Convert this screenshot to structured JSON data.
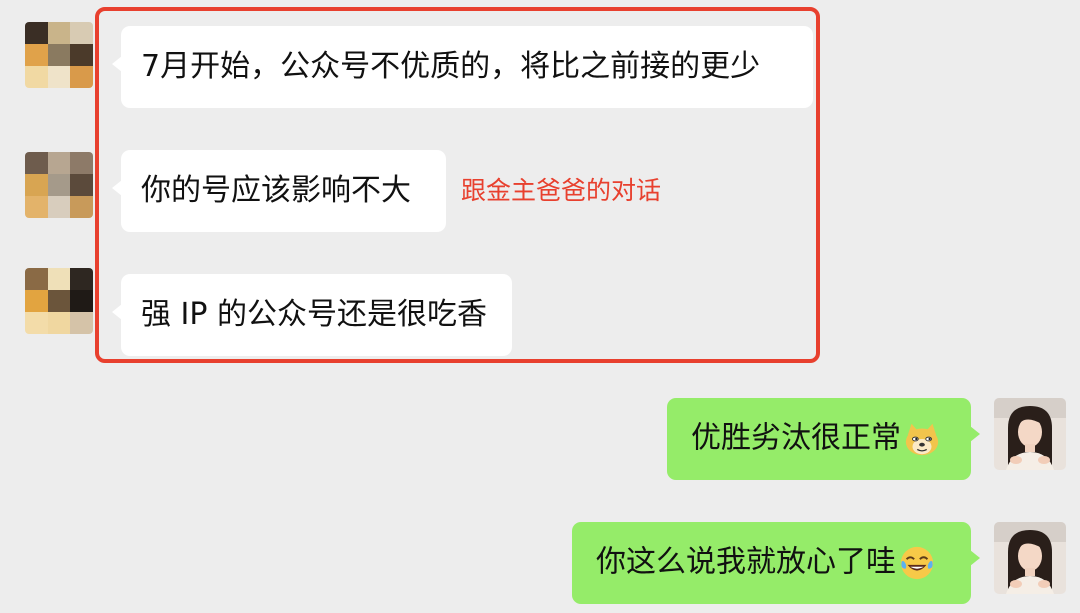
{
  "chat": {
    "incoming": [
      {
        "text": "7月开始，公众号不优质的，将比之前接的更少"
      },
      {
        "text": "你的号应该影响不大"
      },
      {
        "text": "强 IP 的公众号还是很吃香"
      }
    ],
    "annotation": "跟金主爸爸的对话",
    "outgoing": [
      {
        "text": "优胜劣汰很正常",
        "emoji": "doge-emoji"
      },
      {
        "text": "你这么说我就放心了哇",
        "emoji": "tears-of-joy-emoji"
      }
    ]
  },
  "colors": {
    "background": "#ededed",
    "incoming_bubble": "#ffffff",
    "outgoing_bubble": "#95ec69",
    "highlight": "#e8402e"
  }
}
